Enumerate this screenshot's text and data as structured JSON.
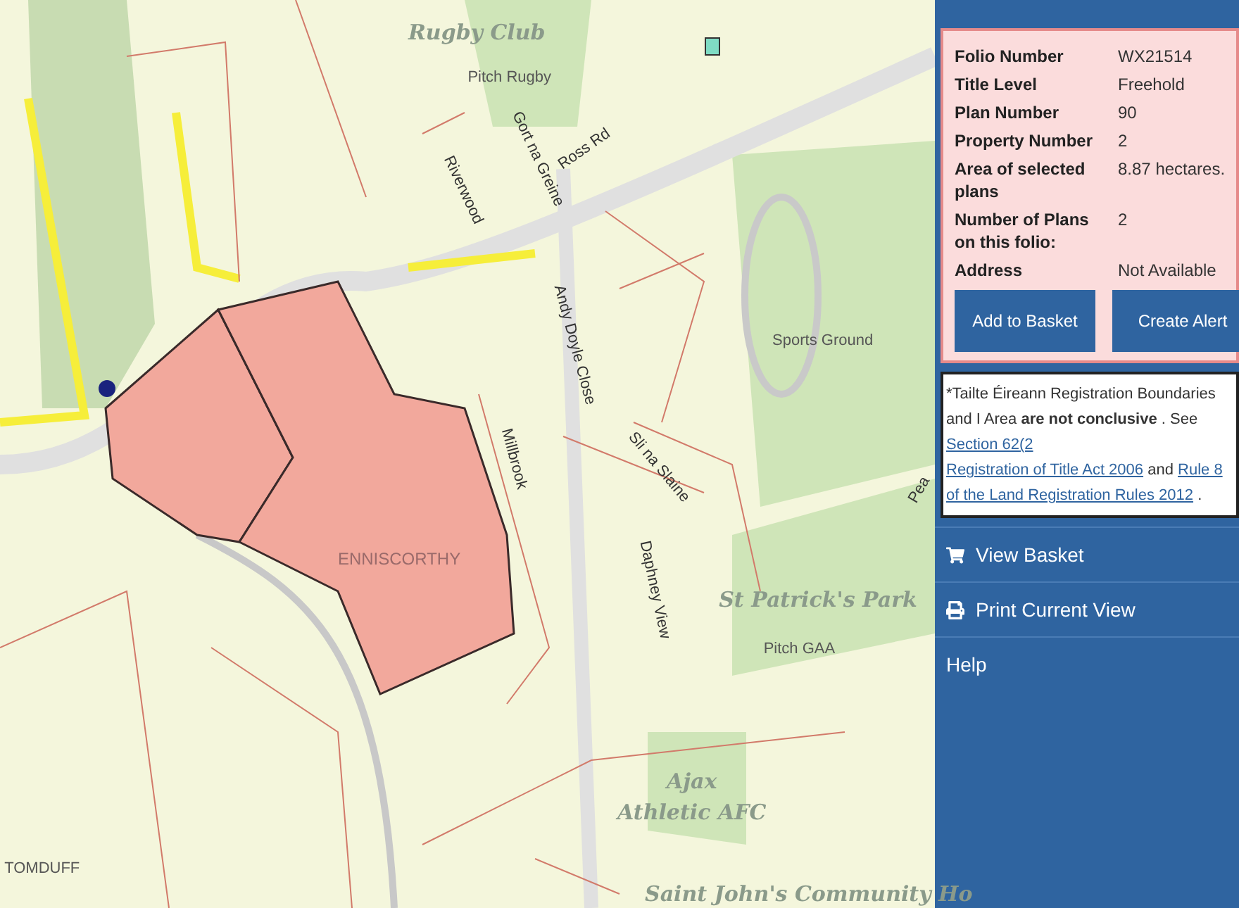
{
  "map": {
    "labels": [
      {
        "text": "Rugby Club",
        "kind": "club"
      },
      {
        "text": "Pitch Rugby",
        "kind": "small"
      },
      {
        "text": "Gort na Greine",
        "kind": "street"
      },
      {
        "text": "Riverwood",
        "kind": "street"
      },
      {
        "text": "Ross Rd",
        "kind": "street"
      },
      {
        "text": "Andy Doyle Close",
        "kind": "street"
      },
      {
        "text": "Sports Ground",
        "kind": "small"
      },
      {
        "text": "Millbrook",
        "kind": "street"
      },
      {
        "text": "Sli na Slaine",
        "kind": "street"
      },
      {
        "text": "Daphney View",
        "kind": "street"
      },
      {
        "text": "ENNISCORTHY",
        "kind": "town"
      },
      {
        "text": "St Patrick's Park",
        "kind": "park"
      },
      {
        "text": "Pitch GAA",
        "kind": "small"
      },
      {
        "text": "Ajax",
        "kind": "park"
      },
      {
        "text": "Athletic AFC",
        "kind": "park"
      },
      {
        "text": "TOMDUFF",
        "kind": "locality"
      },
      {
        "text": "Saint John's Community Ho",
        "kind": "park"
      },
      {
        "text": "Pea",
        "kind": "street"
      }
    ]
  },
  "folio": {
    "fields": [
      {
        "label": "Folio Number",
        "value": "WX21514"
      },
      {
        "label": "Title Level",
        "value": "Freehold"
      },
      {
        "label": "Plan Number",
        "value": "90"
      },
      {
        "label": "Property Number",
        "value": "2"
      },
      {
        "label": "Area of selected plans",
        "value": "8.87 hectares."
      },
      {
        "label": "Number of Plans on this folio:",
        "value": "2"
      },
      {
        "label": "Address",
        "value": "Not Available"
      }
    ],
    "buttons": [
      "Add to Basket",
      "Create Alert"
    ]
  },
  "disclaimer": [
    {
      "kind": "plain",
      "text": "*Tailte Éireann Registration Boundaries and I Area"
    },
    {
      "kind": "bold",
      "text": "are not conclusive"
    },
    {
      "kind": "plain",
      "text": ". See"
    },
    {
      "kind": "link",
      "text": "Section 62(2"
    },
    {
      "kind": "link",
      "text": "Registration of Title Act 2006"
    },
    {
      "kind": "plain",
      "text": "and"
    },
    {
      "kind": "link",
      "text": "Rule 8"
    },
    {
      "kind": "link",
      "text": "of the Land Registration Rules 2012"
    },
    {
      "kind": "plain",
      "text": "."
    }
  ],
  "menu": [
    {
      "label": "View Basket"
    },
    {
      "label": "Print Current View"
    },
    {
      "label": "Help"
    }
  ]
}
